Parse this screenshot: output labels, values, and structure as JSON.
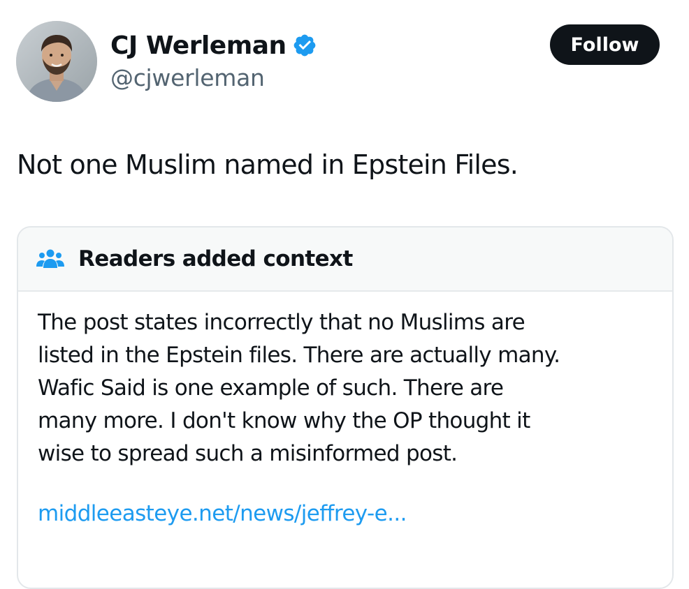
{
  "author": {
    "display_name": "CJ Werleman",
    "handle": "@cjwerleman",
    "verified": true,
    "avatar_icon": "user-avatar-photo"
  },
  "follow_button": {
    "label": "Follow"
  },
  "post": {
    "text": "Not one Muslim named in Epstein Files."
  },
  "community_note": {
    "icon": "people-icon",
    "title": "Readers added context",
    "lines": [
      "The post states incorrectly that no Muslims are",
      "listed in the Epstein files. There are actually many.",
      "Wafic Said is one example of such. There are",
      "many more. I don't know why the OP thought it",
      "wise to spread such a misinformed post."
    ],
    "link_text": "middleeasteye.net/news/jeffrey-e..."
  },
  "colors": {
    "text_primary": "#0f1419",
    "text_secondary": "#536471",
    "link": "#1d9bf0",
    "verified": "#1d9bf0",
    "follow_bg": "#0f1419",
    "note_header_bg": "#f7f9f9",
    "border": "#e3e7ea"
  }
}
